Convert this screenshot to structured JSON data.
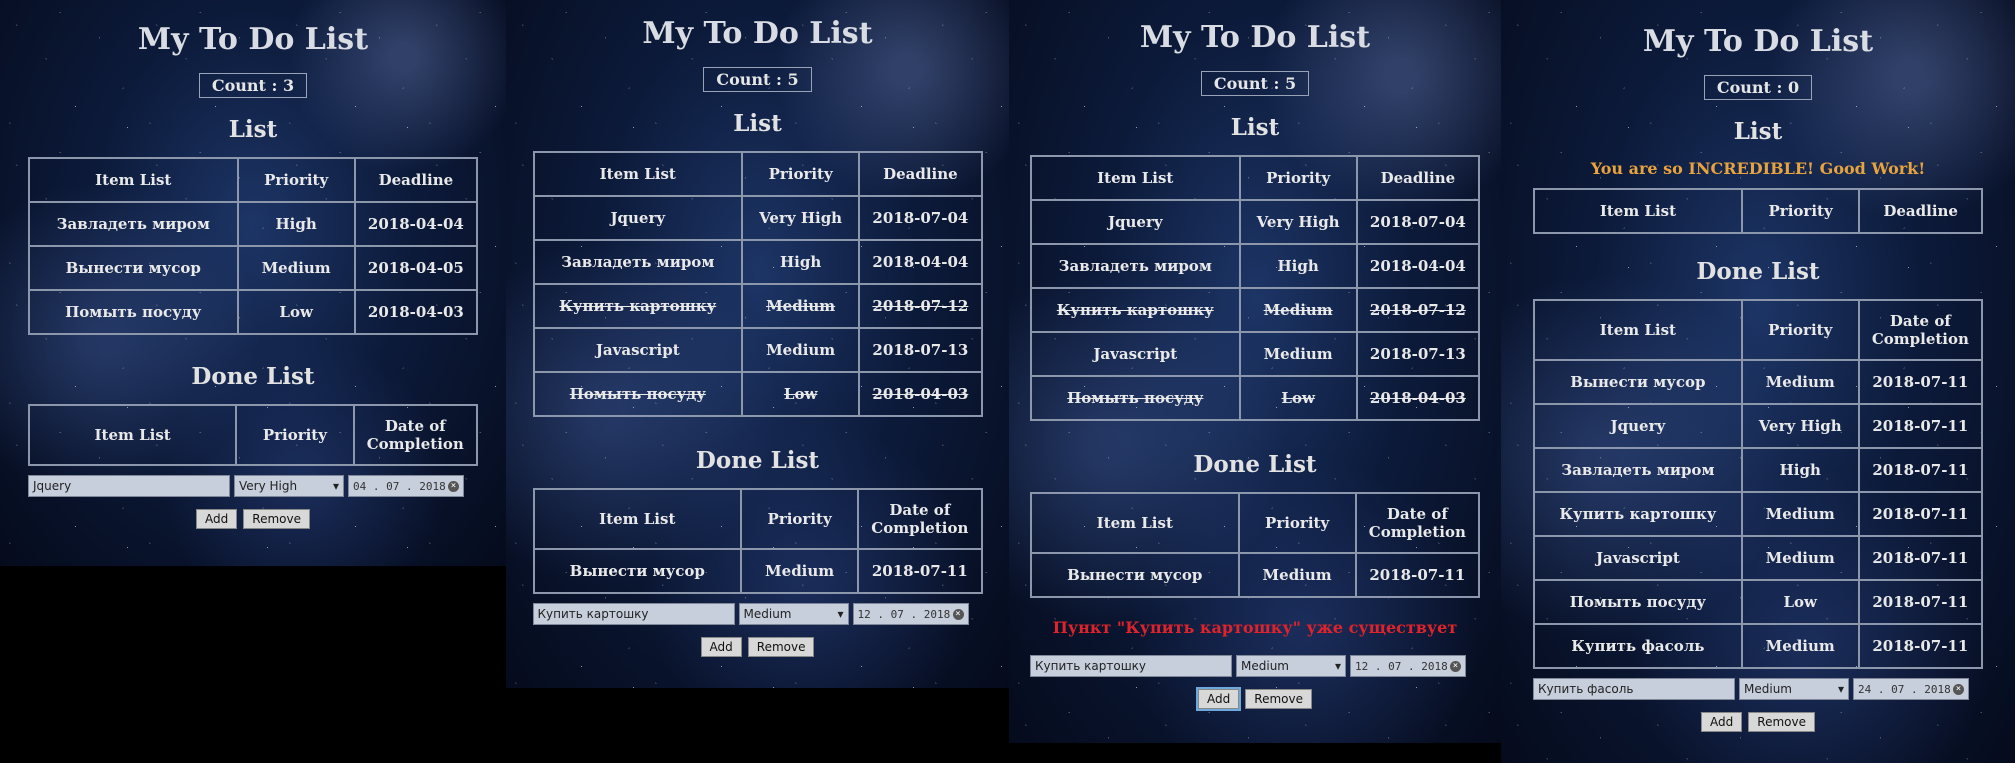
{
  "title": "My To Do List",
  "list_heading": "List",
  "done_heading": "Done List",
  "headers": {
    "item": "Item List",
    "priority": "Priority",
    "deadline": "Deadline",
    "completion": "Date of Completion"
  },
  "buttons": {
    "add": "Add",
    "remove": "Remove"
  },
  "screens": [
    {
      "count": "Count : 3",
      "list": [
        {
          "item": "Завладеть миром",
          "priority": "High",
          "deadline": "2018-04-04"
        },
        {
          "item": "Вынести мусор",
          "priority": "Medium",
          "deadline": "2018-04-05"
        },
        {
          "item": "Помыть посуду",
          "priority": "Low",
          "deadline": "2018-04-03"
        }
      ],
      "done": [],
      "form": {
        "item": "Jquery",
        "priority": "Very High",
        "date": "04 . 07 . 2018"
      }
    },
    {
      "count": "Count : 5",
      "list": [
        {
          "item": "Jquery",
          "priority": "Very High",
          "deadline": "2018-07-04"
        },
        {
          "item": "Завладеть миром",
          "priority": "High",
          "deadline": "2018-04-04"
        },
        {
          "item": "Купить картошку",
          "priority": "Medium",
          "deadline": "2018-07-12",
          "done": true
        },
        {
          "item": "Javascript",
          "priority": "Medium",
          "deadline": "2018-07-13"
        },
        {
          "item": "Помыть посуду",
          "priority": "Low",
          "deadline": "2018-04-03",
          "done": true
        }
      ],
      "done": [
        {
          "item": "Вынести мусор",
          "priority": "Medium",
          "date": "2018-07-11"
        }
      ],
      "form": {
        "item": "Купить картошку",
        "priority": "Medium",
        "date": "12 . 07 . 2018"
      }
    },
    {
      "count": "Count : 5",
      "list": [
        {
          "item": "Jquery",
          "priority": "Very High",
          "deadline": "2018-07-04"
        },
        {
          "item": "Завладеть миром",
          "priority": "High",
          "deadline": "2018-04-04"
        },
        {
          "item": "Купить картошку",
          "priority": "Medium",
          "deadline": "2018-07-12",
          "done": true
        },
        {
          "item": "Javascript",
          "priority": "Medium",
          "deadline": "2018-07-13"
        },
        {
          "item": "Помыть посуду",
          "priority": "Low",
          "deadline": "2018-04-03",
          "done": true
        }
      ],
      "done": [
        {
          "item": "Вынести мусор",
          "priority": "Medium",
          "date": "2018-07-11"
        }
      ],
      "error": "Пункт \"Купить картошку\" уже существует",
      "form": {
        "item": "Купить картошку",
        "priority": "Medium",
        "date": "12 . 07 . 2018"
      }
    },
    {
      "count": "Count : 0",
      "message": "You are so INCREDIBLE! Good Work!",
      "list": [],
      "done": [
        {
          "item": "Вынести мусор",
          "priority": "Medium",
          "date": "2018-07-11"
        },
        {
          "item": "Jquery",
          "priority": "Very High",
          "date": "2018-07-11"
        },
        {
          "item": "Завладеть миром",
          "priority": "High",
          "date": "2018-07-11"
        },
        {
          "item": "Купить картошку",
          "priority": "Medium",
          "date": "2018-07-11"
        },
        {
          "item": "Javascript",
          "priority": "Medium",
          "date": "2018-07-11"
        },
        {
          "item": "Помыть посуду",
          "priority": "Low",
          "date": "2018-07-11"
        },
        {
          "item": "Купить фасоль",
          "priority": "Medium",
          "date": "2018-07-11"
        }
      ],
      "form": {
        "item": "Купить фасоль",
        "priority": "Medium",
        "date": "24 . 07 . 2018"
      }
    }
  ]
}
